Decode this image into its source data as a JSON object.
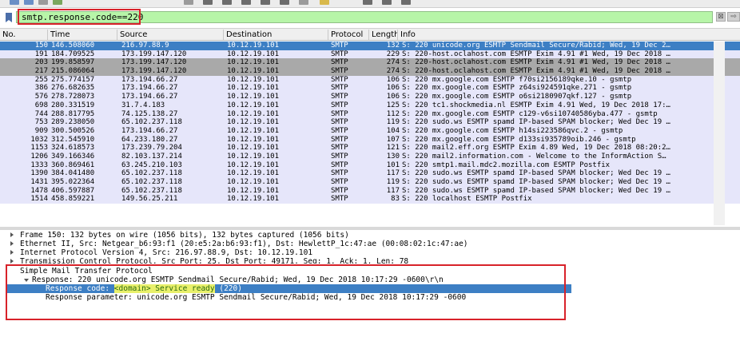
{
  "toolbar": {
    "icons": [
      "open-file-icon",
      "save-icon",
      "close-icon",
      "reload-icon",
      "find-icon",
      "go-back-icon",
      "go-forward-icon",
      "jump-icon",
      "first-icon",
      "last-icon",
      "autoscroll-icon",
      "colorize-icon",
      "zoom-in-icon",
      "zoom-out-icon",
      "zoom-reset-icon"
    ]
  },
  "filter": {
    "value": "smtp.response.code==220",
    "clear_label": "⊠",
    "apply_label": "⇨"
  },
  "columns": [
    "No.",
    "Time",
    "Source",
    "Destination",
    "Protocol",
    "Length",
    "Info"
  ],
  "packets": [
    {
      "no": "150",
      "time": "146.508060",
      "src": "216.97.88.9",
      "dst": "10.12.19.101",
      "proto": "SMTP",
      "len": "132",
      "info": "S: 220 unicode.org ESMTP Sendmail Secure/Rabid; Wed, 19 Dec 2…",
      "style": "selected"
    },
    {
      "no": "191",
      "time": "184.709525",
      "src": "173.199.147.120",
      "dst": "10.12.19.101",
      "proto": "SMTP",
      "len": "229",
      "info": "S: 220-host.oclahost.com ESMTP Exim 4.91 #1 Wed, 19 Dec 2018 …",
      "style": "normal"
    },
    {
      "no": "203",
      "time": "199.858597",
      "src": "173.199.147.120",
      "dst": "10.12.19.101",
      "proto": "SMTP",
      "len": "274",
      "info": "S: 220-host.oclahost.com ESMTP Exim 4.91 #1 Wed, 19 Dec 2018 …",
      "style": "dark"
    },
    {
      "no": "217",
      "time": "215.086064",
      "src": "173.199.147.120",
      "dst": "10.12.19.101",
      "proto": "SMTP",
      "len": "274",
      "info": "S: 220-host.oclahost.com ESMTP Exim 4.91 #1 Wed, 19 Dec 2018 …",
      "style": "dark"
    },
    {
      "no": "255",
      "time": "275.774157",
      "src": "173.194.66.27",
      "dst": "10.12.19.101",
      "proto": "SMTP",
      "len": "106",
      "info": "S: 220 mx.google.com ESMTP f70si2156189qke.10 - gsmtp",
      "style": "normal"
    },
    {
      "no": "386",
      "time": "276.682635",
      "src": "173.194.66.27",
      "dst": "10.12.19.101",
      "proto": "SMTP",
      "len": "106",
      "info": "S: 220 mx.google.com ESMTP z64si924591qke.271 - gsmtp",
      "style": "normal"
    },
    {
      "no": "576",
      "time": "278.728073",
      "src": "173.194.66.27",
      "dst": "10.12.19.101",
      "proto": "SMTP",
      "len": "106",
      "info": "S: 220 mx.google.com ESMTP o6si2180907qkf.127 - gsmtp",
      "style": "normal"
    },
    {
      "no": "698",
      "time": "280.331519",
      "src": "31.7.4.183",
      "dst": "10.12.19.101",
      "proto": "SMTP",
      "len": "125",
      "info": "S: 220 tc1.shockmedia.nl ESMTP Exim 4.91 Wed, 19 Dec 2018 17:…",
      "style": "normal"
    },
    {
      "no": "744",
      "time": "288.817795",
      "src": "74.125.138.27",
      "dst": "10.12.19.101",
      "proto": "SMTP",
      "len": "112",
      "info": "S: 220 mx.google.com ESMTP c129-v6si10740586yba.477 - gsmtp",
      "style": "normal"
    },
    {
      "no": "753",
      "time": "289.238050",
      "src": "65.102.237.118",
      "dst": "10.12.19.101",
      "proto": "SMTP",
      "len": "119",
      "info": "S: 220 sudo.ws ESMTP spamd IP-based SPAM blocker; Wed Dec 19 …",
      "style": "normal"
    },
    {
      "no": "909",
      "time": "300.500526",
      "src": "173.194.66.27",
      "dst": "10.12.19.101",
      "proto": "SMTP",
      "len": "104",
      "info": "S: 220 mx.google.com ESMTP h14si223586qvc.2 - gsmtp",
      "style": "normal"
    },
    {
      "no": "1032",
      "time": "312.545910",
      "src": "64.233.180.27",
      "dst": "10.12.19.101",
      "proto": "SMTP",
      "len": "107",
      "info": "S: 220 mx.google.com ESMTP d133si935789oib.246 - gsmtp",
      "style": "normal"
    },
    {
      "no": "1153",
      "time": "324.618573",
      "src": "173.239.79.204",
      "dst": "10.12.19.101",
      "proto": "SMTP",
      "len": "121",
      "info": "S: 220 mail2.eff.org ESMTP Exim 4.89 Wed, 19 Dec 2018 08:20:2…",
      "style": "normal"
    },
    {
      "no": "1206",
      "time": "349.166346",
      "src": "82.103.137.214",
      "dst": "10.12.19.101",
      "proto": "SMTP",
      "len": "130",
      "info": "S: 220 mail2.information.com - Welcome to the InformAction S…",
      "style": "normal"
    },
    {
      "no": "1333",
      "time": "360.869461",
      "src": "63.245.210.103",
      "dst": "10.12.19.101",
      "proto": "SMTP",
      "len": "101",
      "info": "S: 220 smtp1.mail.mdc2.mozilla.com ESMTP Postfix",
      "style": "normal"
    },
    {
      "no": "1390",
      "time": "384.041480",
      "src": "65.102.237.118",
      "dst": "10.12.19.101",
      "proto": "SMTP",
      "len": "117",
      "info": "S: 220 sudo.ws ESMTP spamd IP-based SPAM blocker; Wed Dec 19 …",
      "style": "normal"
    },
    {
      "no": "1431",
      "time": "395.022364",
      "src": "65.102.237.118",
      "dst": "10.12.19.101",
      "proto": "SMTP",
      "len": "119",
      "info": "S: 220 sudo.ws ESMTP spamd IP-based SPAM blocker; Wed Dec 19 …",
      "style": "normal"
    },
    {
      "no": "1478",
      "time": "406.597887",
      "src": "65.102.237.118",
      "dst": "10.12.19.101",
      "proto": "SMTP",
      "len": "117",
      "info": "S: 220 sudo.ws ESMTP spamd IP-based SPAM blocker; Wed Dec 19 …",
      "style": "normal"
    },
    {
      "no": "1514",
      "time": "458.859221",
      "src": "149.56.25.211",
      "dst": "10.12.19.101",
      "proto": "SMTP",
      "len": "83",
      "info": "S: 220 localhost ESMTP Postfix",
      "style": "normal"
    }
  ],
  "details": {
    "frame": "Frame 150: 132 bytes on wire (1056 bits), 132 bytes captured (1056 bits)",
    "ethernet": "Ethernet II, Src: Netgear_b6:93:f1 (20:e5:2a:b6:93:f1), Dst: HewlettP_1c:47:ae (00:08:02:1c:47:ae)",
    "ip": "Internet Protocol Version 4, Src: 216.97.88.9, Dst: 10.12.19.101",
    "tcp": "Transmission Control Protocol, Src Port: 25, Dst Port: 49171, Seq: 1, Ack: 1, Len: 78",
    "smtp": "Simple Mail Transfer Protocol",
    "response": "Response: 220 unicode.org ESMTP Sendmail Secure/Rabid; Wed, 19 Dec 2018 10:17:29 -0600\\r\\n",
    "response_code_label": "Response code: ",
    "response_code_value": "<domain> Service ready",
    "response_code_num": " (220)",
    "response_param": "Response parameter: unicode.org ESMTP Sendmail Secure/Rabid; Wed, 19 Dec 2018 10:17:29 -0600"
  },
  "colors": {
    "filter_bg": "#b7f5a8",
    "selected_row": "#3d7fc4",
    "row_bg": "#e6e6fa",
    "dark_row": "#a9a9a9",
    "annotation_red": "#d8222a"
  }
}
